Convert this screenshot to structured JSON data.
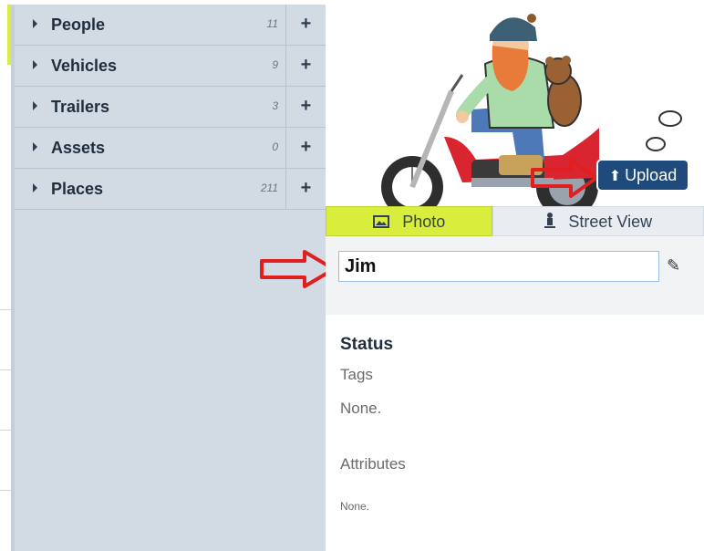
{
  "sidebar": {
    "categories": [
      {
        "label": "People",
        "count": "11"
      },
      {
        "label": "Vehicles",
        "count": "9"
      },
      {
        "label": "Trailers",
        "count": "3"
      },
      {
        "label": "Assets",
        "count": "0"
      },
      {
        "label": "Places",
        "count": "211"
      }
    ],
    "add_glyph": "+"
  },
  "hero": {
    "icon": "biker-with-bear-illustration"
  },
  "upload": {
    "label": "Upload"
  },
  "tabs": {
    "photo": "Photo",
    "street_view": "Street View"
  },
  "name_field": {
    "value": "Jim"
  },
  "details": {
    "status_heading": "Status",
    "tags_label": "Tags",
    "tags_value": "None.",
    "attributes_label": "Attributes",
    "attributes_value": "None."
  },
  "colors": {
    "accent": "#d9ee3c",
    "sidebar_bg": "#d2dae3",
    "upload_bg": "#1e4b7c",
    "annotation_arrow": "#e02020"
  }
}
